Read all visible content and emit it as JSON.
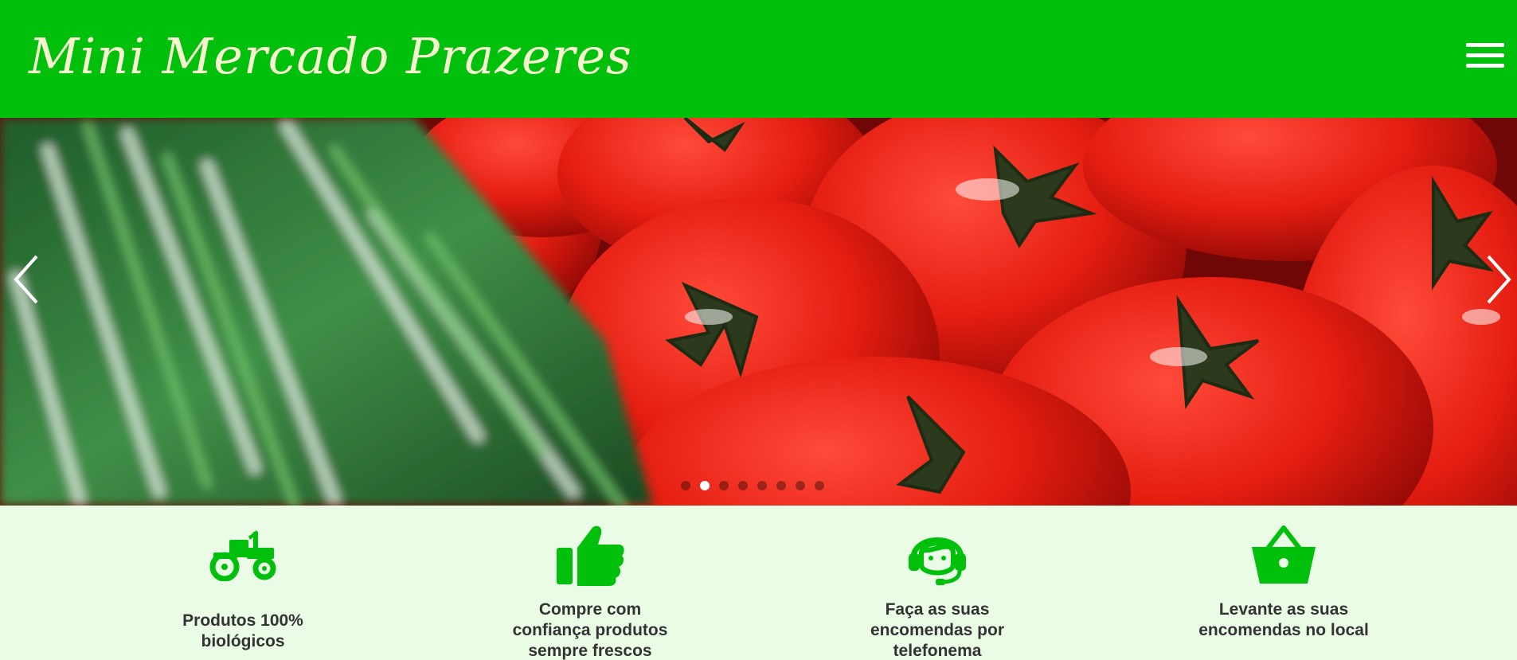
{
  "header": {
    "brand": "Mini Mercado Prazeres",
    "menu_icon": "hamburger-menu-icon",
    "background_color": "#00c00b",
    "brand_color": "#f6f3d0"
  },
  "carousel": {
    "image": "tomatoes-and-herbs",
    "prev_icon": "chevron-left-icon",
    "next_icon": "chevron-right-icon",
    "slide_count": 8,
    "active_slide": 2
  },
  "features": {
    "items": [
      {
        "icon": "tractor-icon",
        "label": "Produtos 100% biológicos"
      },
      {
        "icon": "thumbs-up-icon",
        "label": "Compre com confiança produtos sempre frescos"
      },
      {
        "icon": "headset-support-icon",
        "label": "Faça as suas encomendas por telefonema"
      },
      {
        "icon": "shopping-basket-icon",
        "label": "Levante as suas encomendas no local"
      }
    ],
    "icon_color": "#00c00b",
    "background_color": "#ebfce6"
  }
}
